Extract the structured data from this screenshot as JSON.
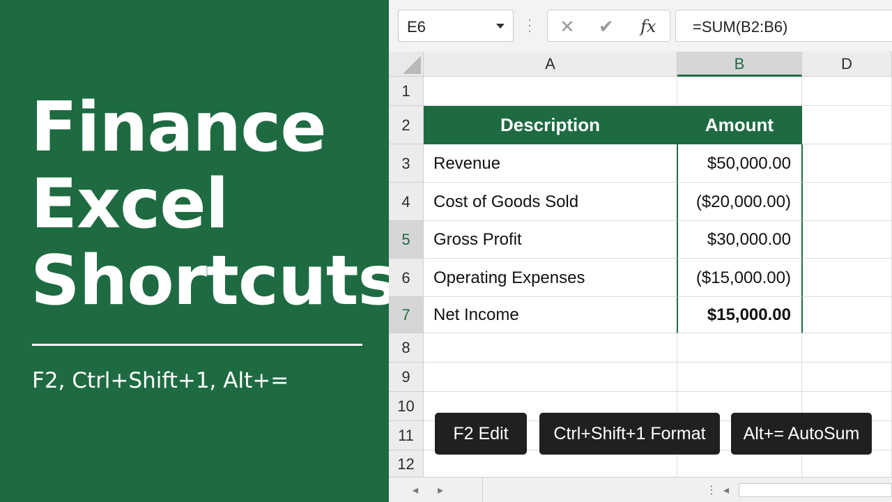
{
  "promo": {
    "title_lines": [
      "Finance",
      "Excel",
      "Shortcuts"
    ],
    "subtitle": "F2, Ctrl+Shift+1, Alt+="
  },
  "formula_bar": {
    "name_box": "E6",
    "cancel_icon": "✕",
    "confirm_icon": "✔",
    "fx_label": "fx",
    "formula": "=SUM(B2:B6)"
  },
  "columns": [
    "A",
    "B",
    "D"
  ],
  "rows": [
    "1",
    "2",
    "3",
    "4",
    "5",
    "6",
    "7",
    "8",
    "9",
    "10",
    "11",
    "12"
  ],
  "table": {
    "headers": [
      "Description",
      "Amount"
    ],
    "rows": [
      {
        "description": "Revenue",
        "amount": "$50,000.00"
      },
      {
        "description": "Cost of Goods Sold",
        "amount": "($20,000.00)"
      },
      {
        "description": "Gross Profit",
        "amount": "$30,000.00"
      },
      {
        "description": "Operating Expenses",
        "amount": "($15,000.00)"
      },
      {
        "description": "Net Income",
        "amount": "$15,000.00"
      }
    ]
  },
  "shortcut_buttons": [
    "F2 Edit",
    "Ctrl+Shift+1 Format",
    "Alt+= AutoSum"
  ],
  "colors": {
    "excel_green": "#1e6b41",
    "button_dark": "#202020"
  },
  "icons": {
    "nav_prev": "previous-sheet-icon",
    "nav_next": "next-sheet-icon"
  }
}
